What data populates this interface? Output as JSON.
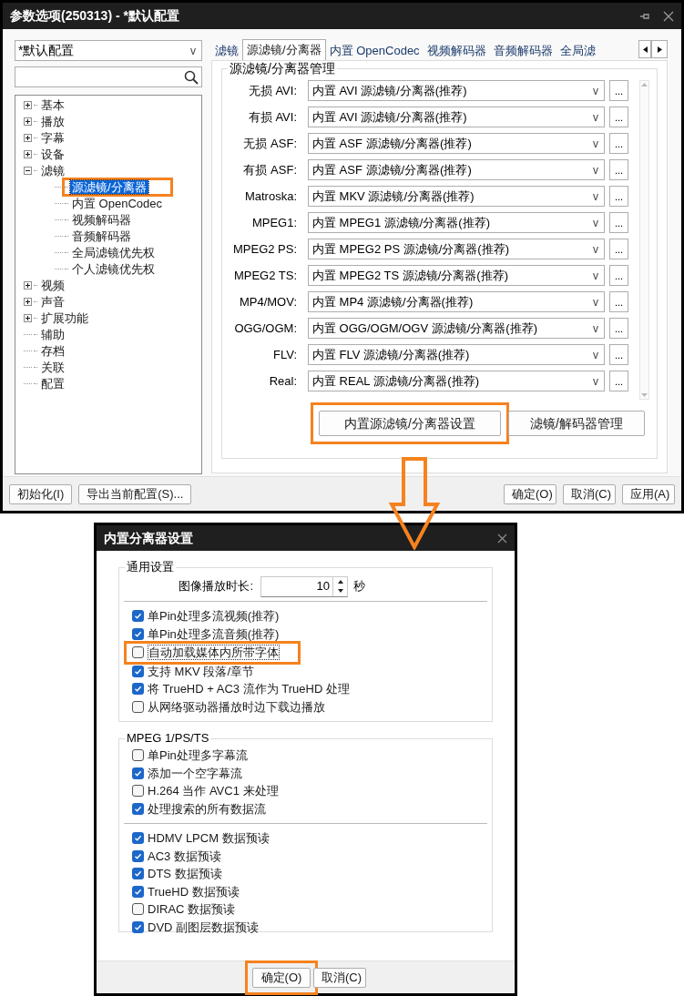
{
  "settings_window": {
    "title": "参数选项(250313) - *默认配置",
    "profile_select": {
      "value": "*默认配置",
      "caret": "v"
    },
    "tree": [
      {
        "label": "基本",
        "kind": "folder",
        "expanded": false,
        "selected": false,
        "highlighted": false
      },
      {
        "label": "播放",
        "kind": "folder",
        "expanded": false,
        "selected": false,
        "highlighted": false
      },
      {
        "label": "字幕",
        "kind": "folder",
        "expanded": false,
        "selected": false,
        "highlighted": false
      },
      {
        "label": "设备",
        "kind": "folder",
        "expanded": false,
        "selected": false,
        "highlighted": false
      },
      {
        "label": "滤镜",
        "kind": "folder",
        "expanded": true,
        "selected": false,
        "highlighted": false,
        "children": [
          {
            "label": "源滤镜/分离器",
            "selected": true,
            "highlighted": true
          },
          {
            "label": "内置 OpenCodec",
            "selected": false,
            "highlighted": false
          },
          {
            "label": "视频解码器",
            "selected": false,
            "highlighted": false
          },
          {
            "label": "音频解码器",
            "selected": false,
            "highlighted": false
          },
          {
            "label": "全局滤镜优先权",
            "selected": false,
            "highlighted": false
          },
          {
            "label": "个人滤镜优先权",
            "selected": false,
            "highlighted": false
          }
        ]
      },
      {
        "label": "视频",
        "kind": "folder",
        "expanded": false,
        "selected": false,
        "highlighted": false
      },
      {
        "label": "声音",
        "kind": "folder",
        "expanded": false,
        "selected": false,
        "highlighted": false
      },
      {
        "label": "扩展功能",
        "kind": "folder",
        "expanded": false,
        "selected": false,
        "highlighted": false
      },
      {
        "label": "辅助",
        "kind": "leaf",
        "selected": false,
        "highlighted": false
      },
      {
        "label": "存档",
        "kind": "leaf",
        "selected": false,
        "highlighted": false
      },
      {
        "label": "关联",
        "kind": "leaf",
        "selected": false,
        "highlighted": false
      },
      {
        "label": "配置",
        "kind": "leaf",
        "selected": false,
        "highlighted": false
      }
    ],
    "tabs": [
      {
        "label": "滤镜",
        "selected": false
      },
      {
        "label": "源滤镜/分离器",
        "selected": true
      },
      {
        "label": "内置 OpenCodec",
        "selected": false
      },
      {
        "label": "视频解码器",
        "selected": false
      },
      {
        "label": "音频解码器",
        "selected": false
      },
      {
        "label": "全局滤",
        "selected": false
      }
    ],
    "group_title": "源滤镜/分离器管理",
    "rows": [
      {
        "label": "无损 AVI:",
        "value": "内置 AVI 源滤镜/分离器(推荐)",
        "caret": "v",
        "more": "..."
      },
      {
        "label": "有损 AVI:",
        "value": "内置 AVI 源滤镜/分离器(推荐)",
        "caret": "v",
        "more": "..."
      },
      {
        "label": "无损 ASF:",
        "value": "内置 ASF 源滤镜/分离器(推荐)",
        "caret": "v",
        "more": "..."
      },
      {
        "label": "有损 ASF:",
        "value": "内置 ASF 源滤镜/分离器(推荐)",
        "caret": "v",
        "more": "..."
      },
      {
        "label": "Matroska:",
        "value": "内置 MKV 源滤镜/分离器(推荐)",
        "caret": "v",
        "more": "..."
      },
      {
        "label": "MPEG1:",
        "value": "内置 MPEG1 源滤镜/分离器(推荐)",
        "caret": "v",
        "more": "..."
      },
      {
        "label": "MPEG2 PS:",
        "value": "内置 MPEG2 PS 源滤镜/分离器(推荐)",
        "caret": "v",
        "more": "..."
      },
      {
        "label": "MPEG2 TS:",
        "value": "内置 MPEG2 TS 源滤镜/分离器(推荐)",
        "caret": "v",
        "more": "..."
      },
      {
        "label": "MP4/MOV:",
        "value": "内置 MP4 源滤镜/分离器(推荐)",
        "caret": "v",
        "more": "..."
      },
      {
        "label": "OGG/OGM:",
        "value": "内置 OGG/OGM/OGV 源滤镜/分离器(推荐)",
        "caret": "v",
        "more": "..."
      },
      {
        "label": "FLV:",
        "value": "内置 FLV 源滤镜/分离器(推荐)",
        "caret": "v",
        "more": "..."
      },
      {
        "label": "Real:",
        "value": "内置 REAL 源滤镜/分离器(推荐)",
        "caret": "v",
        "more": "..."
      }
    ],
    "actions": [
      {
        "label": "内置源滤镜/分离器设置",
        "highlighted": true
      },
      {
        "label": "滤镜/解码器管理",
        "highlighted": false
      }
    ],
    "footer_left": [
      "初始化(I)",
      "导出当前配置(S)..."
    ],
    "footer_right": [
      "确定(O)",
      "取消(C)",
      "应用(A)"
    ]
  },
  "splitter_dialog": {
    "title": "内置分离器设置",
    "general": {
      "title": "通用设置",
      "duration": {
        "label": "图像播放时长:",
        "value": "10",
        "unit": "秒"
      },
      "options": [
        {
          "label": "单Pin处理多流视频(推荐)",
          "checked": true,
          "highlighted": false
        },
        {
          "label": "单Pin处理多流音频(推荐)",
          "checked": true,
          "highlighted": false
        },
        {
          "label": "自动加载媒体内所带字体",
          "checked": false,
          "highlighted": true
        },
        {
          "label": "支持 MKV 段落/章节",
          "checked": true,
          "highlighted": false
        },
        {
          "label": "将 TrueHD + AC3 流作为 TrueHD 处理",
          "checked": true,
          "highlighted": false
        },
        {
          "label": "从网络驱动器播放时边下载边播放",
          "checked": false,
          "highlighted": false
        }
      ]
    },
    "mpeg": {
      "title": "MPEG 1/PS/TS",
      "options": [
        {
          "label": "单Pin处理多字幕流",
          "checked": false,
          "highlighted": false
        },
        {
          "label": "添加一个空字幕流",
          "checked": true,
          "highlighted": false
        },
        {
          "label": "H.264 当作 AVC1 来处理",
          "checked": false,
          "highlighted": false
        },
        {
          "label": "处理搜索的所有数据流",
          "checked": true,
          "highlighted": false
        }
      ],
      "preread": [
        {
          "label": "HDMV LPCM 数据预读",
          "checked": true,
          "highlighted": false
        },
        {
          "label": "AC3 数据预读",
          "checked": true,
          "highlighted": false
        },
        {
          "label": "DTS 数据预读",
          "checked": true,
          "highlighted": false
        },
        {
          "label": "TrueHD 数据预读",
          "checked": true,
          "highlighted": false
        },
        {
          "label": "DIRAC 数据预读",
          "checked": false,
          "highlighted": false
        },
        {
          "label": "DVD 副图层数据预读",
          "checked": true,
          "highlighted": false
        }
      ]
    },
    "buttons": [
      {
        "label": "确定(O)",
        "highlighted": true
      },
      {
        "label": "取消(C)",
        "highlighted": false
      }
    ]
  }
}
